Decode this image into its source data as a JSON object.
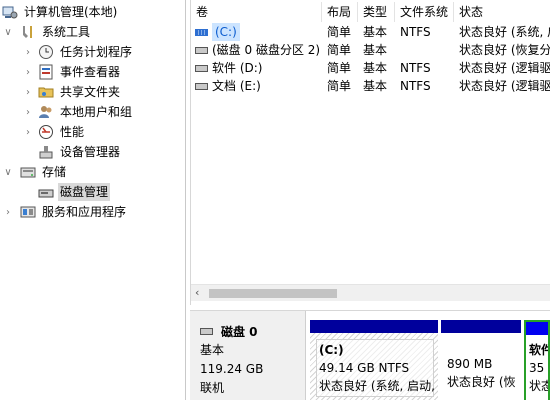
{
  "tree": {
    "root": "计算机管理(本地)",
    "system_tools": "系统工具",
    "task_scheduler": "任务计划程序",
    "event_viewer": "事件查看器",
    "shared_folders": "共享文件夹",
    "local_users": "本地用户和组",
    "performance": "性能",
    "device_manager": "设备管理器",
    "storage": "存储",
    "disk_management": "磁盘管理",
    "services_apps": "服务和应用程序"
  },
  "volumes": {
    "columns": [
      "卷",
      "布局",
      "类型",
      "文件系统",
      "状态"
    ],
    "rows": [
      {
        "name": "(C:)",
        "layout": "简单",
        "type": "基本",
        "fs": "NTFS",
        "status": "状态良好 (系统, 启"
      },
      {
        "name": "(磁盘 0 磁盘分区 2)",
        "layout": "简单",
        "type": "基本",
        "fs": "",
        "status": "状态良好 (恢复分"
      },
      {
        "name": "软件 (D:)",
        "layout": "简单",
        "type": "基本",
        "fs": "NTFS",
        "status": "状态良好 (逻辑驱"
      },
      {
        "name": "文档 (E:)",
        "layout": "简单",
        "type": "基本",
        "fs": "NTFS",
        "status": "状态良好 (逻辑驱"
      }
    ]
  },
  "disk": {
    "name": "磁盘 0",
    "kind": "基本",
    "size": "119.24 GB",
    "state": "联机",
    "partitions": [
      {
        "title": "(C:)",
        "size": "49.14 GB NTFS",
        "status": "状态良好 (系统, 启动,"
      },
      {
        "title": "",
        "size": "890 MB",
        "status": "状态良好 (恢"
      },
      {
        "title": "软件",
        "size": "35",
        "status": "状态"
      }
    ]
  }
}
